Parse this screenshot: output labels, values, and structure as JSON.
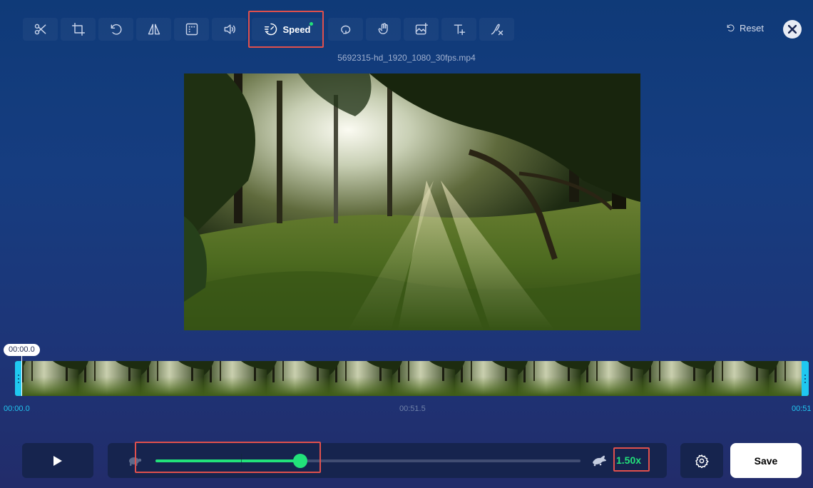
{
  "toolbar": {
    "tools": [
      {
        "icon": "scissors-icon"
      },
      {
        "icon": "crop-icon"
      },
      {
        "icon": "rotate-icon"
      },
      {
        "icon": "flip-icon"
      },
      {
        "icon": "aspect-ratio-icon"
      },
      {
        "icon": "volume-icon"
      },
      {
        "icon": "speed-icon",
        "label": "Speed",
        "active": true
      },
      {
        "icon": "loop-icon"
      },
      {
        "icon": "stabilize-icon"
      },
      {
        "icon": "image-adjust-icon"
      },
      {
        "icon": "text-icon"
      },
      {
        "icon": "remove-watermark-icon"
      }
    ],
    "reset_label": "Reset",
    "close_icon": "close-icon"
  },
  "filename": "5692315-hd_1920_1080_30fps.mp4",
  "timeline": {
    "current_time_bubble": "00:00.0",
    "start_time": "00:00.0",
    "mid_time": "00:51.5",
    "end_time": "00:51",
    "playhead_fraction": 0.0
  },
  "controls": {
    "play_icon": "play-icon",
    "slow_icon": "turtle-icon",
    "fast_icon": "rabbit-icon",
    "speed_fraction": 0.34,
    "speed_value": "1.50x",
    "settings_icon": "gear-icon",
    "save_label": "Save"
  },
  "colors": {
    "accent_green": "#22e17a",
    "accent_cyan": "#1fc8f0",
    "highlight_red": "#e0504d",
    "panel_bg": "#16244e"
  }
}
